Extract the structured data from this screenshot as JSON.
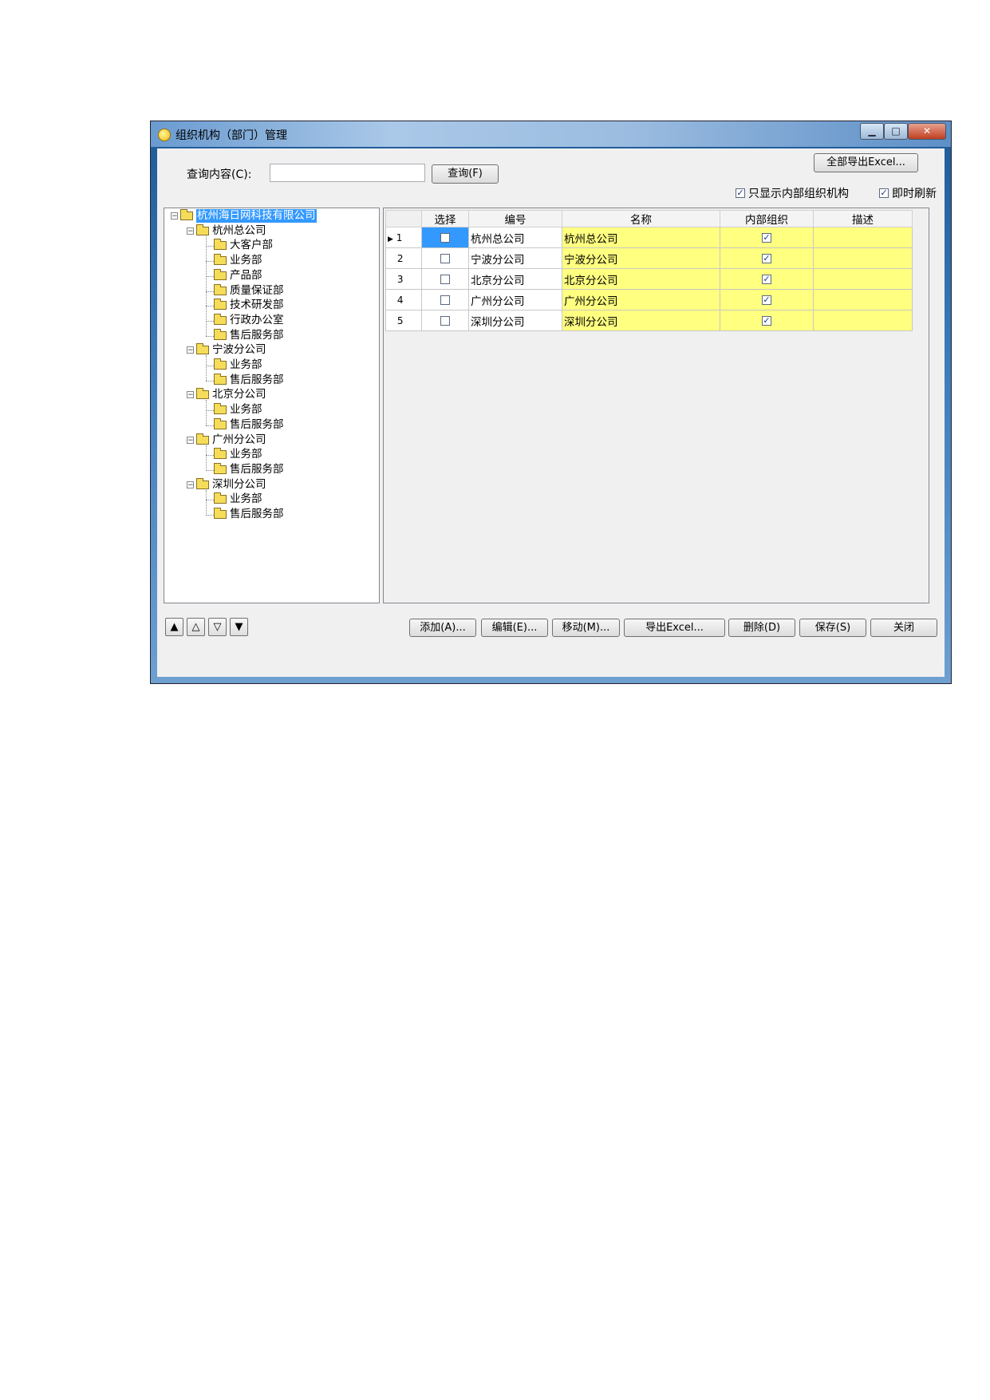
{
  "window": {
    "title": "组织机构（部门）管理"
  },
  "window_buttons": {
    "minimize": "▁",
    "maximize": "□",
    "close": "✕"
  },
  "toolbar": {
    "search_label": "查询内容(C):",
    "search_value": "",
    "search_button": "查询(F)",
    "export_all_button": "全部导出Excel...",
    "only_internal_label": "只显示内部组织机构",
    "only_internal_checked": true,
    "live_refresh_label": "即时刷新",
    "live_refresh_checked": true
  },
  "tree": {
    "root": "杭州海日网科技有限公司",
    "groups": [
      {
        "name": "杭州总公司",
        "children": [
          "大客户部",
          "业务部",
          "产品部",
          "质量保证部",
          "技术研发部",
          "行政办公室",
          "售后服务部"
        ]
      },
      {
        "name": "宁波分公司",
        "children": [
          "业务部",
          "售后服务部"
        ]
      },
      {
        "name": "北京分公司",
        "children": [
          "业务部",
          "售后服务部"
        ]
      },
      {
        "name": "广州分公司",
        "children": [
          "业务部",
          "售后服务部"
        ]
      },
      {
        "name": "深圳分公司",
        "children": [
          "业务部",
          "售后服务部"
        ]
      }
    ]
  },
  "grid": {
    "columns": [
      "选择",
      "编号",
      "名称",
      "内部组织",
      "描述"
    ],
    "rows": [
      {
        "index": "1",
        "current": true,
        "selected": false,
        "code": "杭州总公司",
        "name": "杭州总公司",
        "internal": true,
        "desc": ""
      },
      {
        "index": "2",
        "current": false,
        "selected": false,
        "code": "宁波分公司",
        "name": "宁波分公司",
        "internal": true,
        "desc": ""
      },
      {
        "index": "3",
        "current": false,
        "selected": false,
        "code": "北京分公司",
        "name": "北京分公司",
        "internal": true,
        "desc": ""
      },
      {
        "index": "4",
        "current": false,
        "selected": false,
        "code": "广州分公司",
        "name": "广州分公司",
        "internal": true,
        "desc": ""
      },
      {
        "index": "5",
        "current": false,
        "selected": false,
        "code": "深圳分公司",
        "name": "深圳分公司",
        "internal": true,
        "desc": ""
      }
    ]
  },
  "nav_buttons": {
    "top": "▲",
    "up": "△",
    "down": "▽",
    "bottom": "▼"
  },
  "bottom_buttons": {
    "add": "添加(A)...",
    "edit": "编辑(E)...",
    "move": "移动(M)...",
    "export": "导出Excel...",
    "delete": "删除(D)",
    "save": "保存(S)",
    "close": "关闭"
  },
  "colors": {
    "highlight_cell": "#ffff80",
    "selection": "#3399ff",
    "title_gradient": "#6a9bd0"
  },
  "icons": {
    "title": "app-circle-icon",
    "tree_node": "folder-icon",
    "tree_root": "open-folder-icon",
    "current_row": "row-pointer-icon"
  }
}
